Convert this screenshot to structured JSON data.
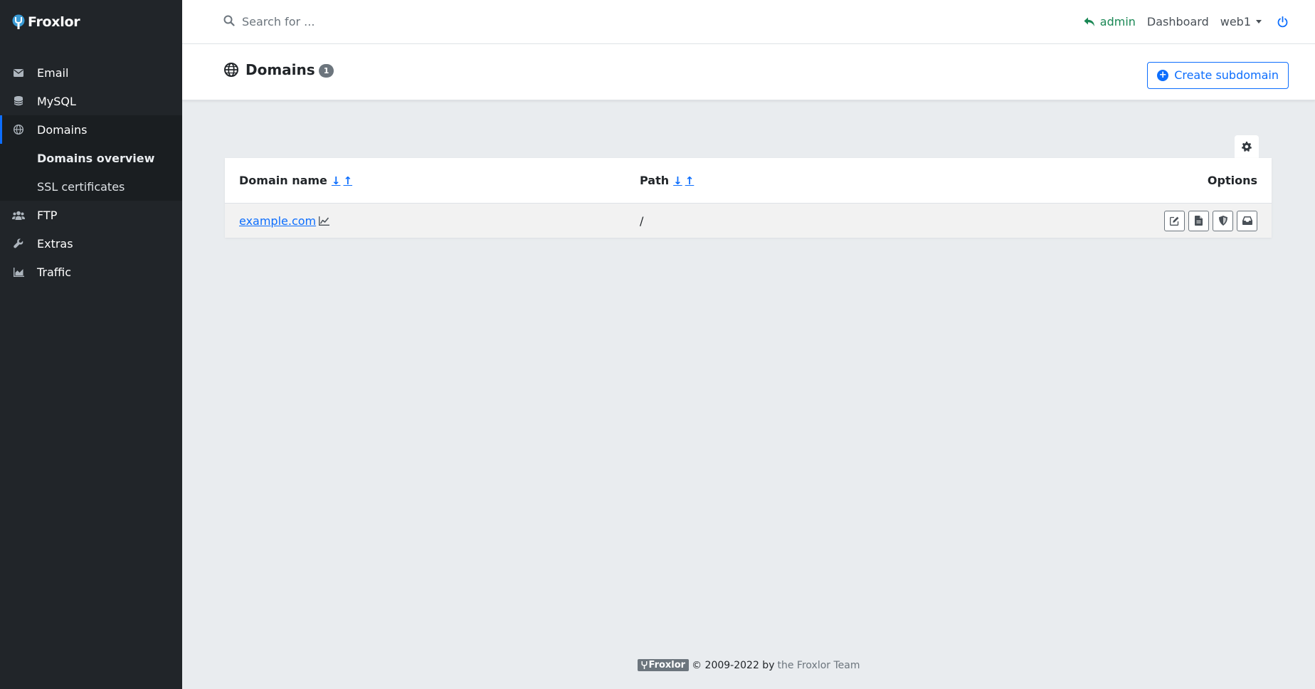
{
  "brand": {
    "name": "Froxlor"
  },
  "sidebar": {
    "items": [
      {
        "label": "Email",
        "icon": "envelope-icon"
      },
      {
        "label": "MySQL",
        "icon": "database-icon"
      },
      {
        "label": "Domains",
        "icon": "globe-icon",
        "active": true
      },
      {
        "label": "FTP",
        "icon": "users-icon"
      },
      {
        "label": "Extras",
        "icon": "wrench-icon"
      },
      {
        "label": "Traffic",
        "icon": "chart-area-icon"
      }
    ],
    "subitems": [
      {
        "label": "Domains overview",
        "active": true
      },
      {
        "label": "SSL certificates"
      }
    ]
  },
  "header": {
    "search_placeholder": "Search for ...",
    "admin_label": "admin",
    "dashboard_label": "Dashboard",
    "user_label": "web1"
  },
  "page": {
    "title": "Domains",
    "count": "1",
    "create_button": "Create subdomain"
  },
  "table": {
    "columns": {
      "domain": "Domain name",
      "path": "Path",
      "options": "Options"
    },
    "sort_desc": "↓",
    "sort_asc": "↑",
    "rows": [
      {
        "domain": "example.com",
        "path": "/"
      }
    ]
  },
  "footer": {
    "logo": "Froxlor",
    "copyright": "© 2009-2022 by",
    "team": "the Froxlor Team"
  },
  "colors": {
    "sidebar_bg": "#212529",
    "accent": "#0d6efd",
    "admin_green": "#198754",
    "page_bg": "#e9ecef"
  }
}
